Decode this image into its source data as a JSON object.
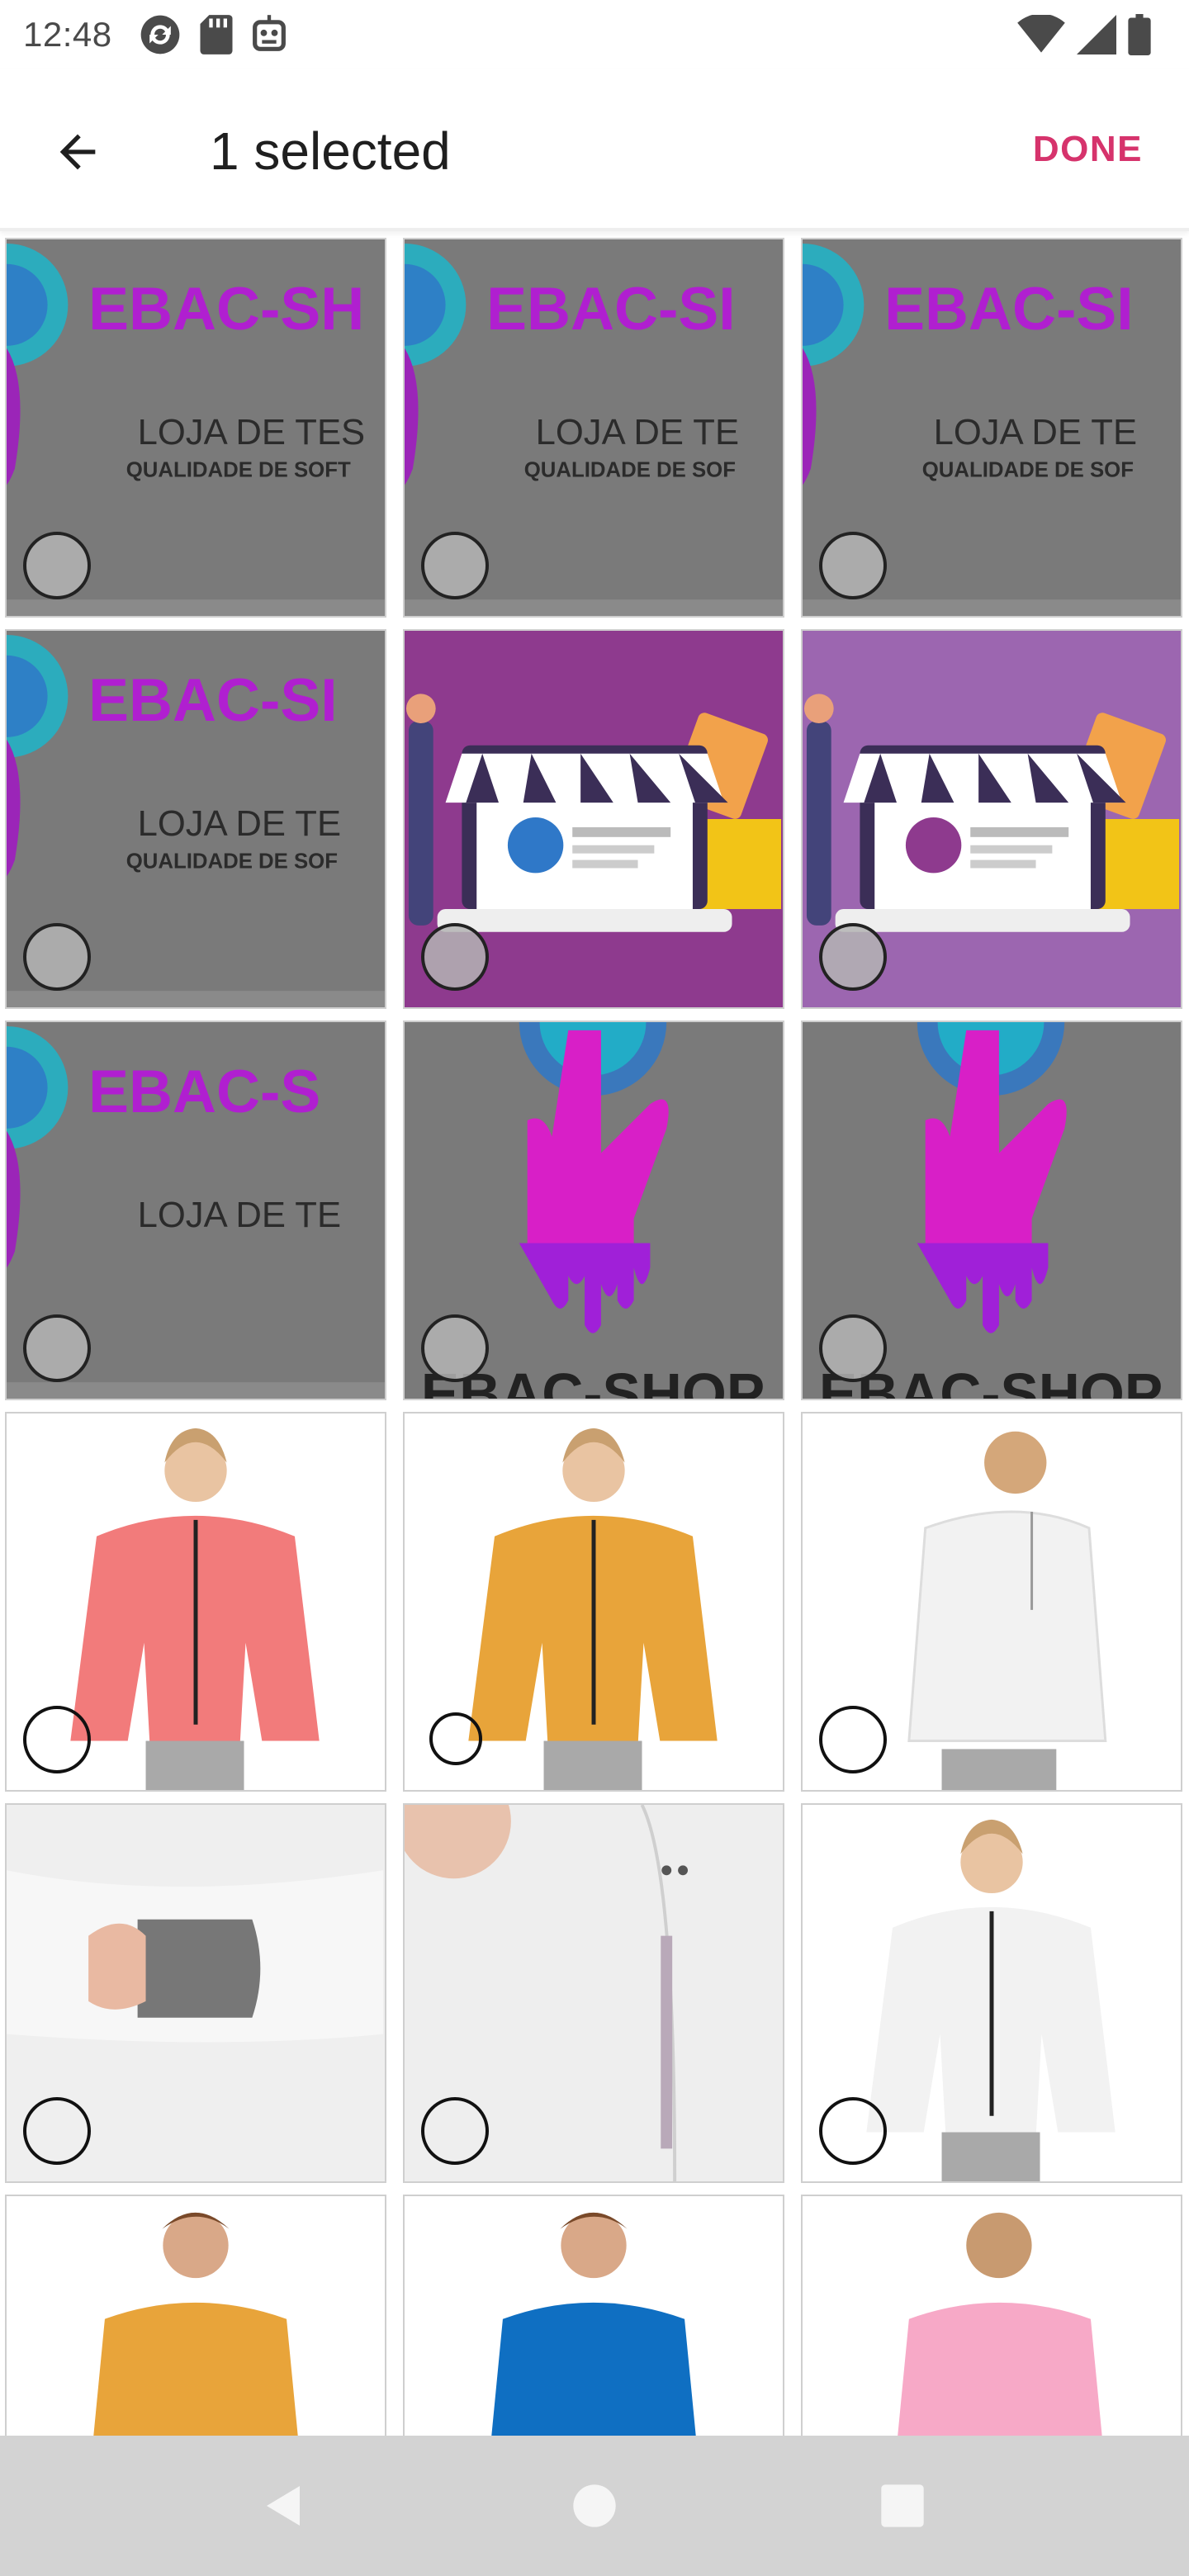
{
  "status_bar": {
    "time": "12:48",
    "left_icons": [
      "sync-icon",
      "sd-card-icon",
      "robot-icon"
    ],
    "right_icons": [
      "wifi-icon",
      "cell-signal-icon",
      "battery-icon"
    ]
  },
  "app_bar": {
    "title": "1 selected",
    "done_label": "DONE",
    "accent_color": "#d6336c"
  },
  "grid": {
    "items": [
      {
        "kind": "ebac-banner",
        "text1": "EBAC-SH",
        "text2": "LOJA DE TES",
        "text3": "QUALIDADE DE SOFT"
      },
      {
        "kind": "ebac-banner",
        "text1": "EBAC-SI",
        "text2": "LOJA DE TE",
        "text3": "QUALIDADE DE SOF"
      },
      {
        "kind": "ebac-banner",
        "text1": "EBAC-SI",
        "text2": "LOJA DE TE",
        "text3": "QUALIDADE DE SOF"
      },
      {
        "kind": "ebac-banner",
        "text1": "EBAC-SI",
        "text2": "LOJA DE TE",
        "text3": "QUALIDADE DE SOF"
      },
      {
        "kind": "store-illustration",
        "variant": "ebac-logo"
      },
      {
        "kind": "store-illustration",
        "variant": "cart-logo"
      },
      {
        "kind": "ebac-banner",
        "text1": "EBAC-S",
        "text2": "LOJA DE TE",
        "text3": ""
      },
      {
        "kind": "ebac-hand",
        "text1": "EBAC-SHOP"
      },
      {
        "kind": "ebac-hand",
        "text1": "EBAC-SHOP"
      },
      {
        "kind": "jacket",
        "color": "#f27b7b"
      },
      {
        "kind": "jacket",
        "color": "#e8a43a"
      },
      {
        "kind": "jacket-back",
        "color": "#f2f2f2"
      },
      {
        "kind": "sleeve",
        "color": "#efefef"
      },
      {
        "kind": "jacket-closeup",
        "color": "#eeeeee"
      },
      {
        "kind": "jacket",
        "color": "#f2f2f2"
      },
      {
        "kind": "pullover",
        "color": "#e8a43a"
      },
      {
        "kind": "pullover",
        "color": "#0f6fc2"
      },
      {
        "kind": "pullover-back",
        "color": "#f7a9c7"
      }
    ]
  },
  "nav_bar": {
    "buttons": [
      "back-nav-icon",
      "home-nav-icon",
      "recents-nav-icon"
    ]
  }
}
